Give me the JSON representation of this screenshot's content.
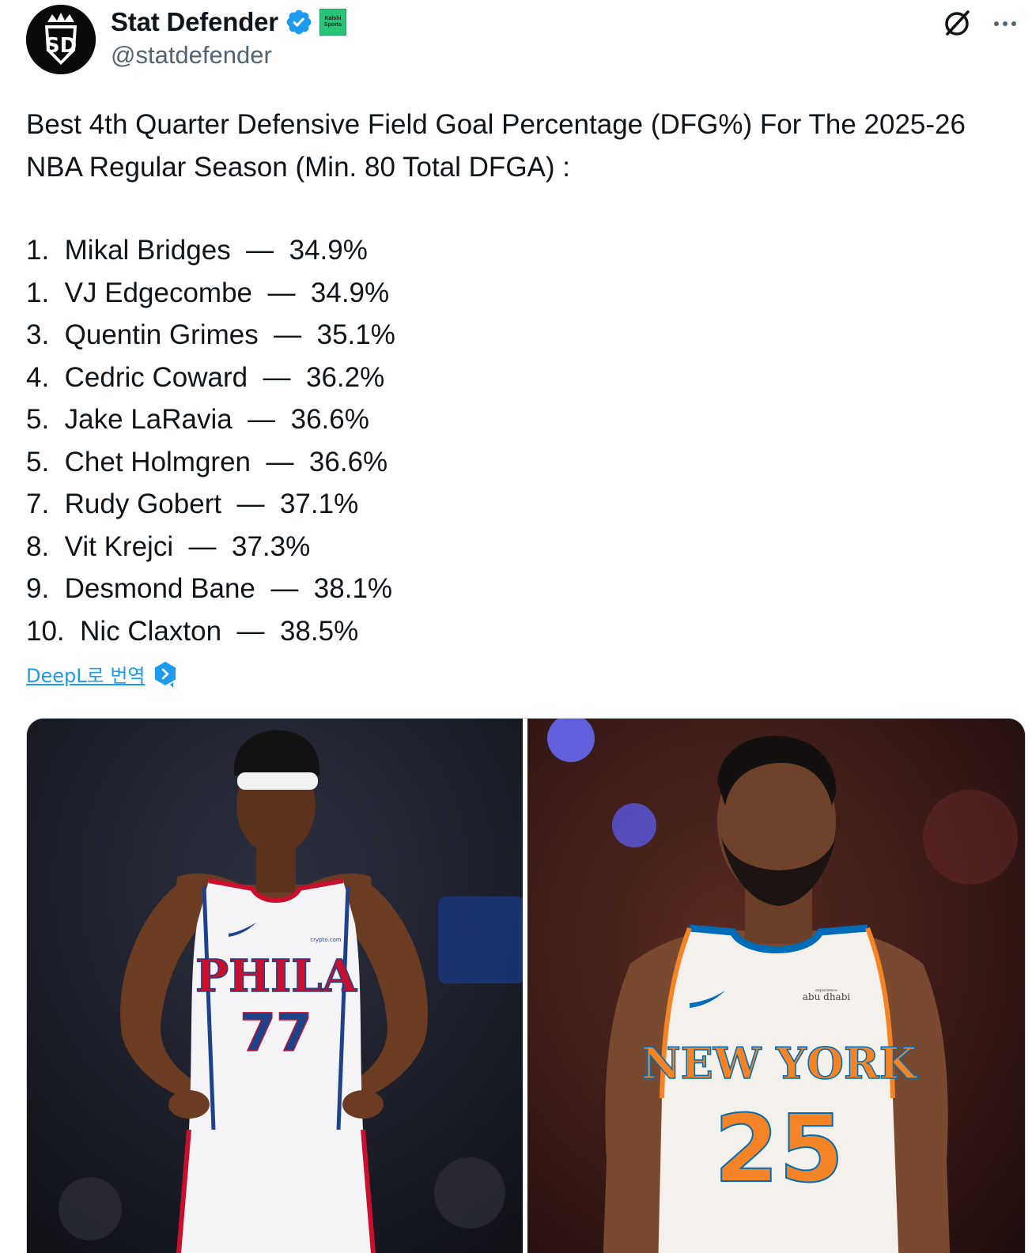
{
  "author": {
    "display_name": "Stat Defender",
    "handle": "@statdefender",
    "avatar_text": "SD",
    "affiliate_badge": [
      "Kalshi",
      "Sports"
    ],
    "verified_color": "#1d9bf0"
  },
  "tweet": {
    "text": "Best 4th Quarter Defensive Field Goal Percentage (DFG%) For The 2025-26 NBA Regular Season (Min. 80 Total DFGA) :",
    "rankings": [
      "1.  Mikal Bridges  —  34.9%",
      "1.  VJ Edgecombe  —  34.9%",
      "3.  Quentin Grimes  —  35.1%",
      "4.  Cedric Coward  —  36.2%",
      "5.  Jake LaRavia  —  36.6%",
      "5.  Chet Holmgren  —  36.6%",
      "7.  Rudy Gobert  —  37.1%",
      "8.  Vit Krejci  —  37.3%",
      "9.  Desmond Bane  —  38.1%",
      "10.  Nic Claxton  —  38.5%"
    ],
    "translate_label": "DeepL로 번역"
  },
  "media": {
    "left_photo": {
      "jersey_text": "PHILA",
      "jersey_number": "77",
      "patch_text": "crypto.com",
      "colors": {
        "jersey": "#f4f4f6",
        "text": "#c8102e",
        "number": "#1d428a"
      }
    },
    "right_photo": {
      "jersey_text": "NEW YORK",
      "jersey_number": "25",
      "patch_text": "abu dhabi",
      "patch_small": "experience",
      "colors": {
        "jersey": "#f4f1ec",
        "text": "#f58426",
        "trim": "#006bb6"
      }
    }
  },
  "icons": {
    "verified": "verified-badge-icon",
    "grok": "grok-icon",
    "more": "more-options-icon",
    "deepl": "deepl-icon"
  },
  "colors": {
    "text_primary": "#0f1419",
    "text_secondary": "#536471",
    "link": "#1d9bf0"
  }
}
